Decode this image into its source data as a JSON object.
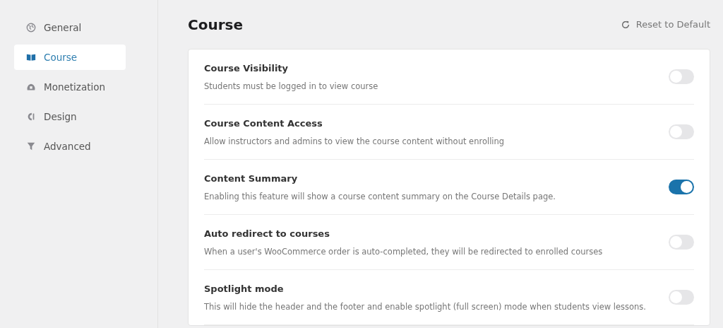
{
  "sidebar": {
    "items": [
      {
        "label": "General",
        "selected": false
      },
      {
        "label": "Course",
        "selected": true
      },
      {
        "label": "Monetization",
        "selected": false
      },
      {
        "label": "Design",
        "selected": false
      },
      {
        "label": "Advanced",
        "selected": false
      }
    ]
  },
  "page": {
    "title": "Course",
    "reset_button": "Reset to Default"
  },
  "settings": [
    {
      "title": "Course Visibility",
      "description": "Students must be logged in to view course",
      "on": false
    },
    {
      "title": "Course Content Access",
      "description": "Allow instructors and admins to view the course content without enrolling",
      "on": false
    },
    {
      "title": "Content Summary",
      "description": "Enabling this feature will show a course content summary on the Course Details page.",
      "on": true
    },
    {
      "title": "Auto redirect to courses",
      "description": "When a user's WooCommerce order is auto-completed, they will be redirected to enrolled courses",
      "on": false
    },
    {
      "title": "Spotlight mode",
      "description": "This will hide the header and the footer and enable spotlight (full screen) mode when students view lessons.",
      "on": false
    }
  ]
}
